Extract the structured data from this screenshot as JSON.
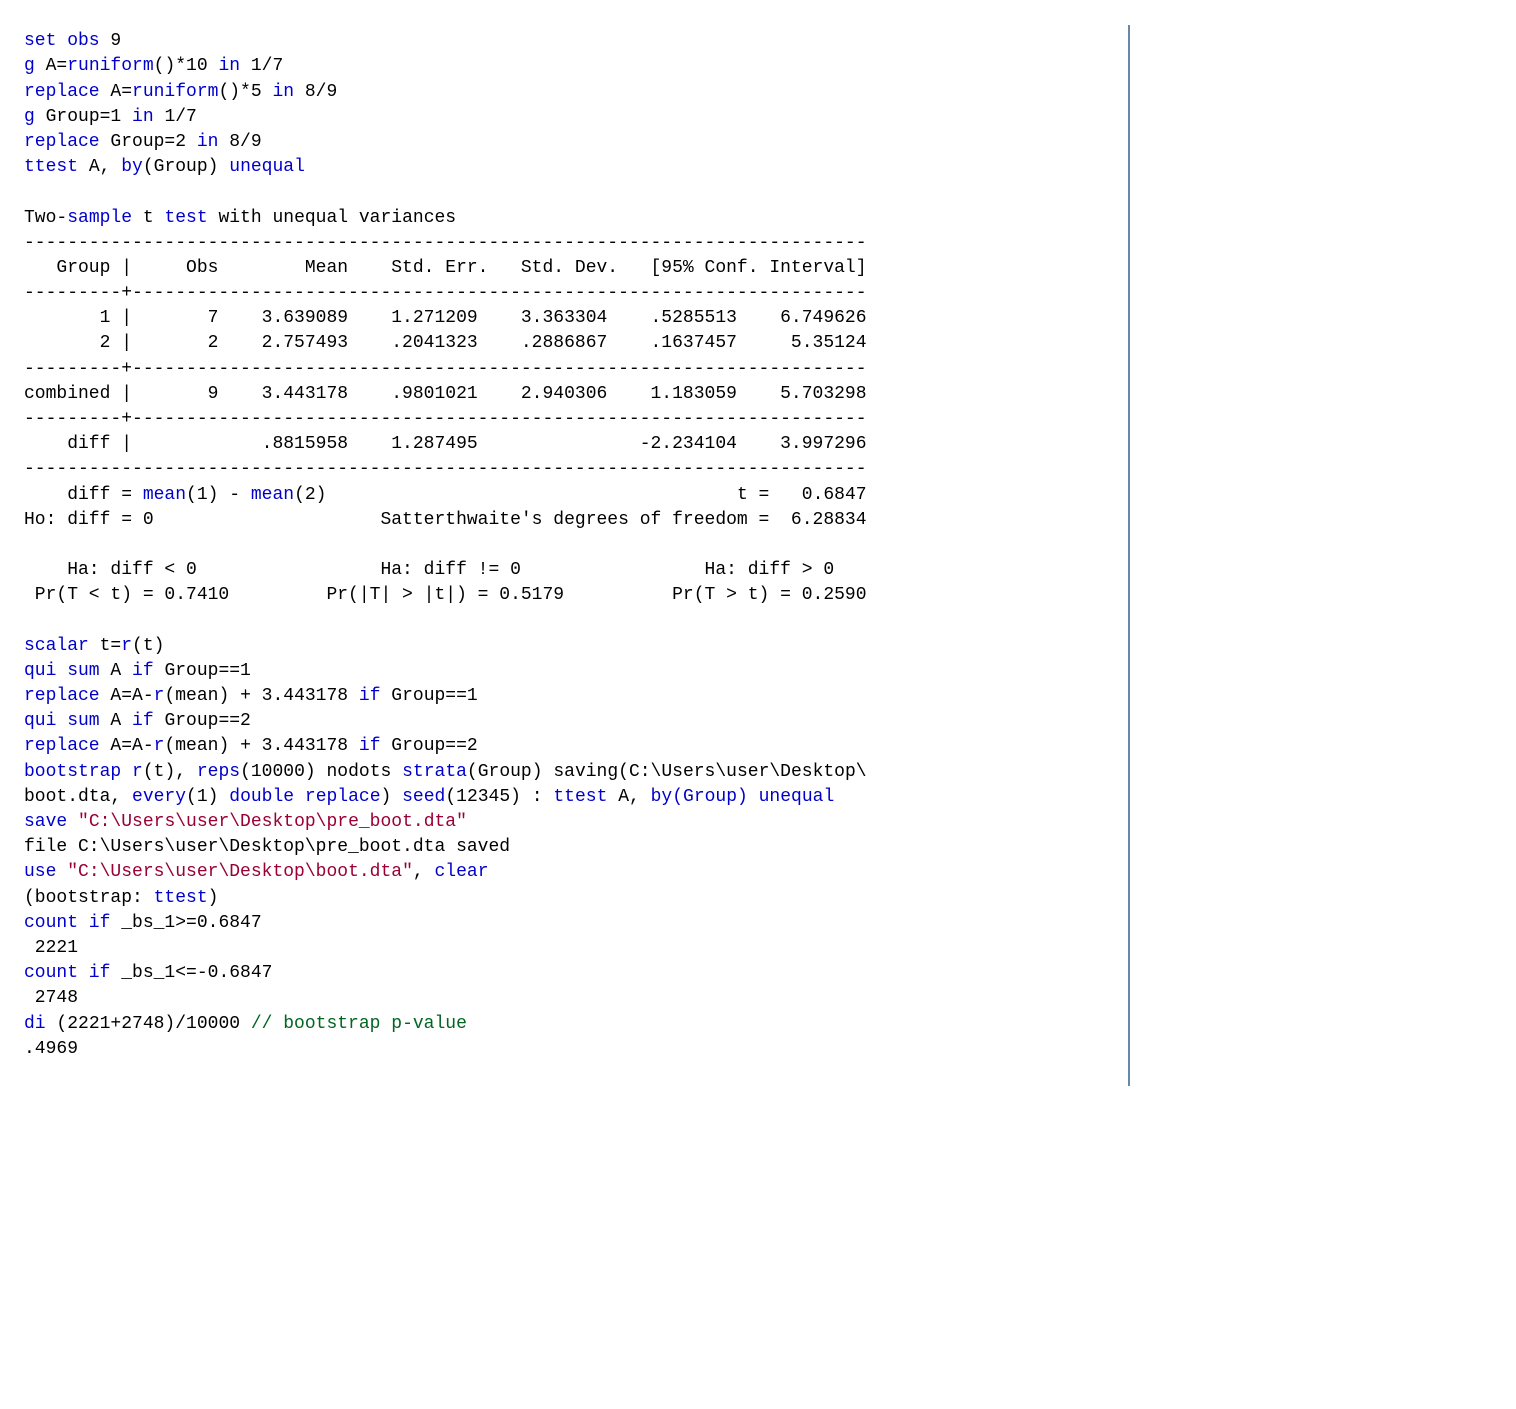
{
  "l1": {
    "a": "set obs",
    "b": " 9"
  },
  "l2": {
    "a": "g",
    "b": " A=",
    "c": "runiform",
    "d": "()*10 ",
    "e": "in",
    "f": " 1/7"
  },
  "l3": {
    "a": "replace",
    "b": " A=",
    "c": "runiform",
    "d": "()*5 ",
    "e": "in",
    "f": " 8/9"
  },
  "l4": {
    "a": "g",
    "b": " Group=1 ",
    "c": "in",
    "d": " 1/7"
  },
  "l5": {
    "a": "replace",
    "b": " Group=2 ",
    "c": "in",
    "d": " 8/9"
  },
  "l6": {
    "a": "ttest",
    "b": " A, ",
    "c": "by",
    "d": "(Group) ",
    "e": "unequal"
  },
  "l8": {
    "a": "Two-",
    "b": "sample",
    "c": " t ",
    "d": "test",
    "e": " with unequal variances"
  },
  "l9": "------------------------------------------------------------------------------",
  "l10": "   Group |     Obs        Mean    Std. Err.   Std. Dev.   [95% Conf. Interval]",
  "l11": "---------+--------------------------------------------------------------------",
  "l12": "       1 |       7    3.639089    1.271209    3.363304    .5285513    6.749626",
  "l13": "       2 |       2    2.757493    .2041323    .2886867    .1637457     5.35124",
  "l14": "---------+--------------------------------------------------------------------",
  "l15": "combined |       9    3.443178    .9801021    2.940306    1.183059    5.703298",
  "l16": "---------+--------------------------------------------------------------------",
  "l17": "    diff |            .8815958    1.287495               -2.234104    3.997296",
  "l18": "------------------------------------------------------------------------------",
  "l19": {
    "a": "    diff = ",
    "b": "mean",
    "c": "(1) - ",
    "d": "mean",
    "e": "(2)                                      t =   0.6847"
  },
  "l20": "Ho: diff = 0                     Satterthwaite's degrees of freedom =  6.28834",
  "l22": "    Ha: diff < 0                 Ha: diff != 0                 Ha: diff > 0",
  "l23": " Pr(T < t) = 0.7410         Pr(|T| > |t|) = 0.5179          Pr(T > t) = 0.2590",
  "l25": {
    "a": "scalar",
    "b": " t=",
    "c": "r",
    "d": "(t)"
  },
  "l26": {
    "a": "qui sum",
    "b": " A ",
    "c": "if",
    "d": " Group==1"
  },
  "l27": {
    "a": "replace",
    "b": " A=A-",
    "c": "r",
    "d": "(mean) + 3.443178 ",
    "e": "if",
    "f": " Group==1"
  },
  "l28": {
    "a": "qui sum",
    "b": " A ",
    "c": "if",
    "d": " Group==2"
  },
  "l29": {
    "a": "replace",
    "b": " A=A-",
    "c": "r",
    "d": "(mean) + 3.443178 ",
    "e": "if",
    "f": " Group==2"
  },
  "l30": {
    "a": "bootstrap",
    "b": " ",
    "c": "r",
    "d": "(t), ",
    "e": "reps",
    "f": "(10000) nodots ",
    "g": "strata",
    "h": "(Group) saving(C:\\Users\\user\\Desktop\\"
  },
  "l31": {
    "a": "boot.dta, ",
    "b": "every",
    "c": "(1) ",
    "d": "double",
    "e": " ",
    "f": "replace",
    "g": ") ",
    "h": "seed",
    "i": "(12345) : ",
    "j": "ttest",
    "k": " A, ",
    "l": "by(Group) unequal"
  },
  "l32": {
    "a": "save",
    "b": " ",
    "c": "\"C:\\Users\\user\\Desktop\\pre_boot.dta\""
  },
  "l33": "file C:\\Users\\user\\Desktop\\pre_boot.dta saved",
  "l34": {
    "a": "use",
    "b": " ",
    "c": "\"C:\\Users\\user\\Desktop\\boot.dta\"",
    "d": ", ",
    "e": "clear"
  },
  "l35": {
    "a": "(bootstrap: ",
    "b": "ttest",
    "c": ")"
  },
  "l36": {
    "a": "count if",
    "b": " _bs_1>=0.6847"
  },
  "l37": " 2221",
  "l38": {
    "a": "count if",
    "b": " _bs_1<=-0.6847"
  },
  "l39": " 2748",
  "l40": {
    "a": "di",
    "b": " (2221+2748)/10000 ",
    "c": "// bootstrap p-value"
  },
  "l41": ".4969"
}
